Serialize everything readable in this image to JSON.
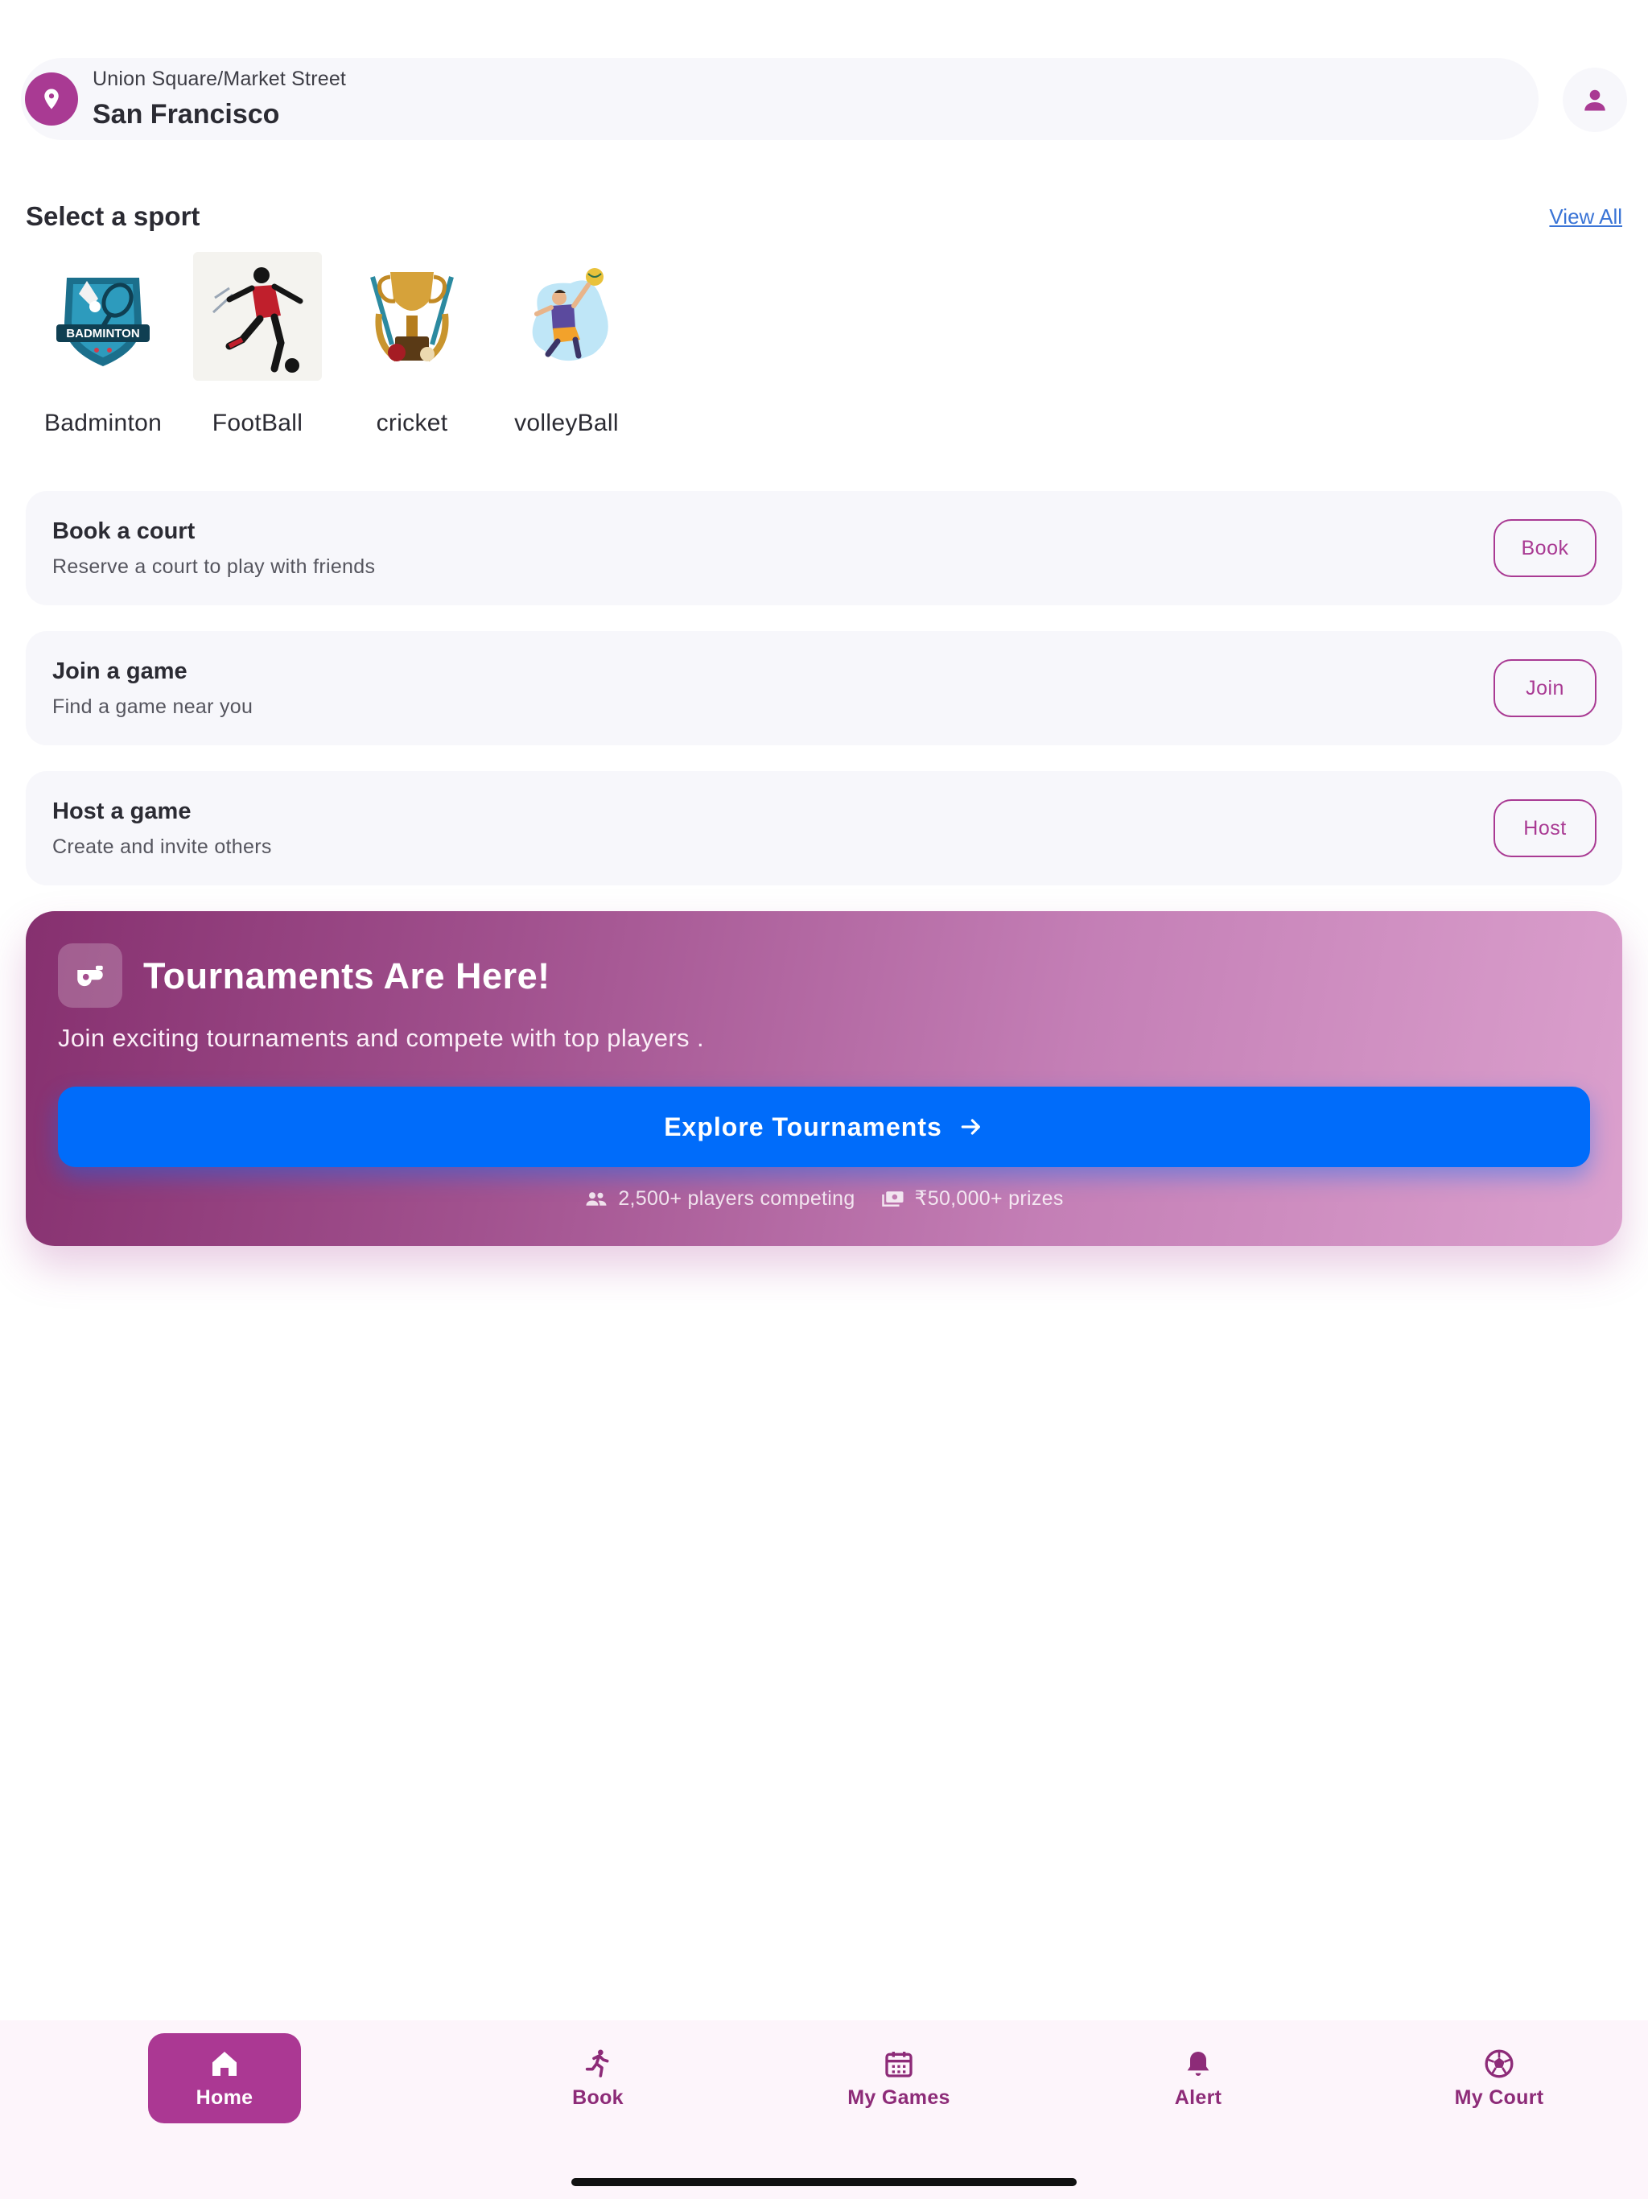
{
  "location": {
    "area": "Union Square/Market Street",
    "city": "San Francisco",
    "pin_icon": "map-pin-icon",
    "profile_icon": "person-icon"
  },
  "sports_section": {
    "title": "Select a sport",
    "view_all": "View All",
    "sports": [
      {
        "label": "Badminton",
        "icon": "badminton-logo",
        "badge_text": "BADMINTON"
      },
      {
        "label": "FootBall",
        "icon": "football-player-image"
      },
      {
        "label": "cricket",
        "icon": "cricket-trophy-image"
      },
      {
        "label": "volleyBall",
        "icon": "volleyball-player-image"
      }
    ]
  },
  "actions": [
    {
      "title": "Book a court",
      "subtitle": "Reserve a court to play with friends",
      "button": "Book"
    },
    {
      "title": "Join a game",
      "subtitle": "Find a game near you",
      "button": "Join"
    },
    {
      "title": "Host a game",
      "subtitle": "Create and invite others",
      "button": "Host"
    }
  ],
  "tournament": {
    "title": "Tournaments Are Here!",
    "subtitle": "Join exciting tournaments and compete with top players .",
    "cta": "Explore Tournaments",
    "players": "2,500+ players competing",
    "prizes": "₹50,000+ prizes"
  },
  "nav": {
    "home": "Home",
    "book": "Book",
    "my_games": "My Games",
    "alert": "Alert",
    "my_court": "My Court"
  },
  "colors": {
    "accent": "#a93a93",
    "cta_blue": "#006cfa",
    "card_bg": "#f7f7fb"
  }
}
